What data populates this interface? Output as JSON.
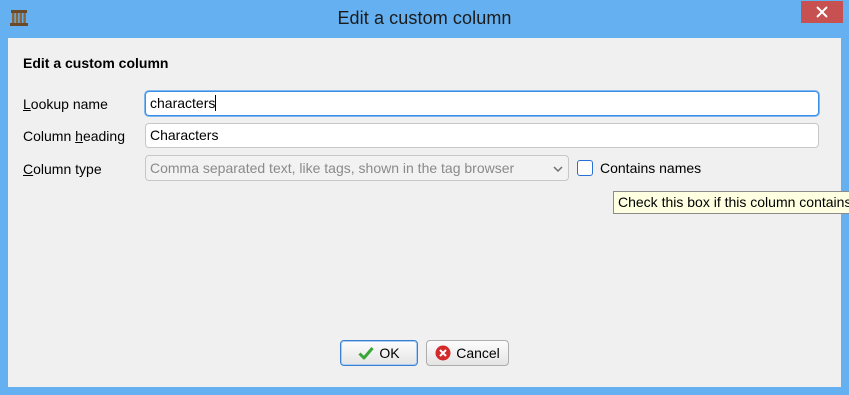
{
  "window": {
    "title": "Edit a custom column"
  },
  "form": {
    "heading": "Edit a custom column",
    "lookup_label_first": "L",
    "lookup_label_rest": "ookup name",
    "lookup_value": "characters",
    "heading_label_pre": "Column ",
    "heading_label_key": "h",
    "heading_label_post": "eading",
    "heading_value": "Characters",
    "type_label_first": "C",
    "type_label_rest": "olumn type",
    "type_value": "Comma separated text, like tags, shown in the tag browser",
    "contains_names_label": "Contains names",
    "contains_names_checked": false,
    "tooltip": "Check this box if this column contains names"
  },
  "buttons": {
    "ok": "OK",
    "cancel": "Cancel"
  },
  "colors": {
    "titlebar": "#64b0f0",
    "close": "#c75050",
    "ok_icon": "#3aa637",
    "cancel_icon": "#d42a2a",
    "tooltip_bg": "#ffffe1"
  }
}
